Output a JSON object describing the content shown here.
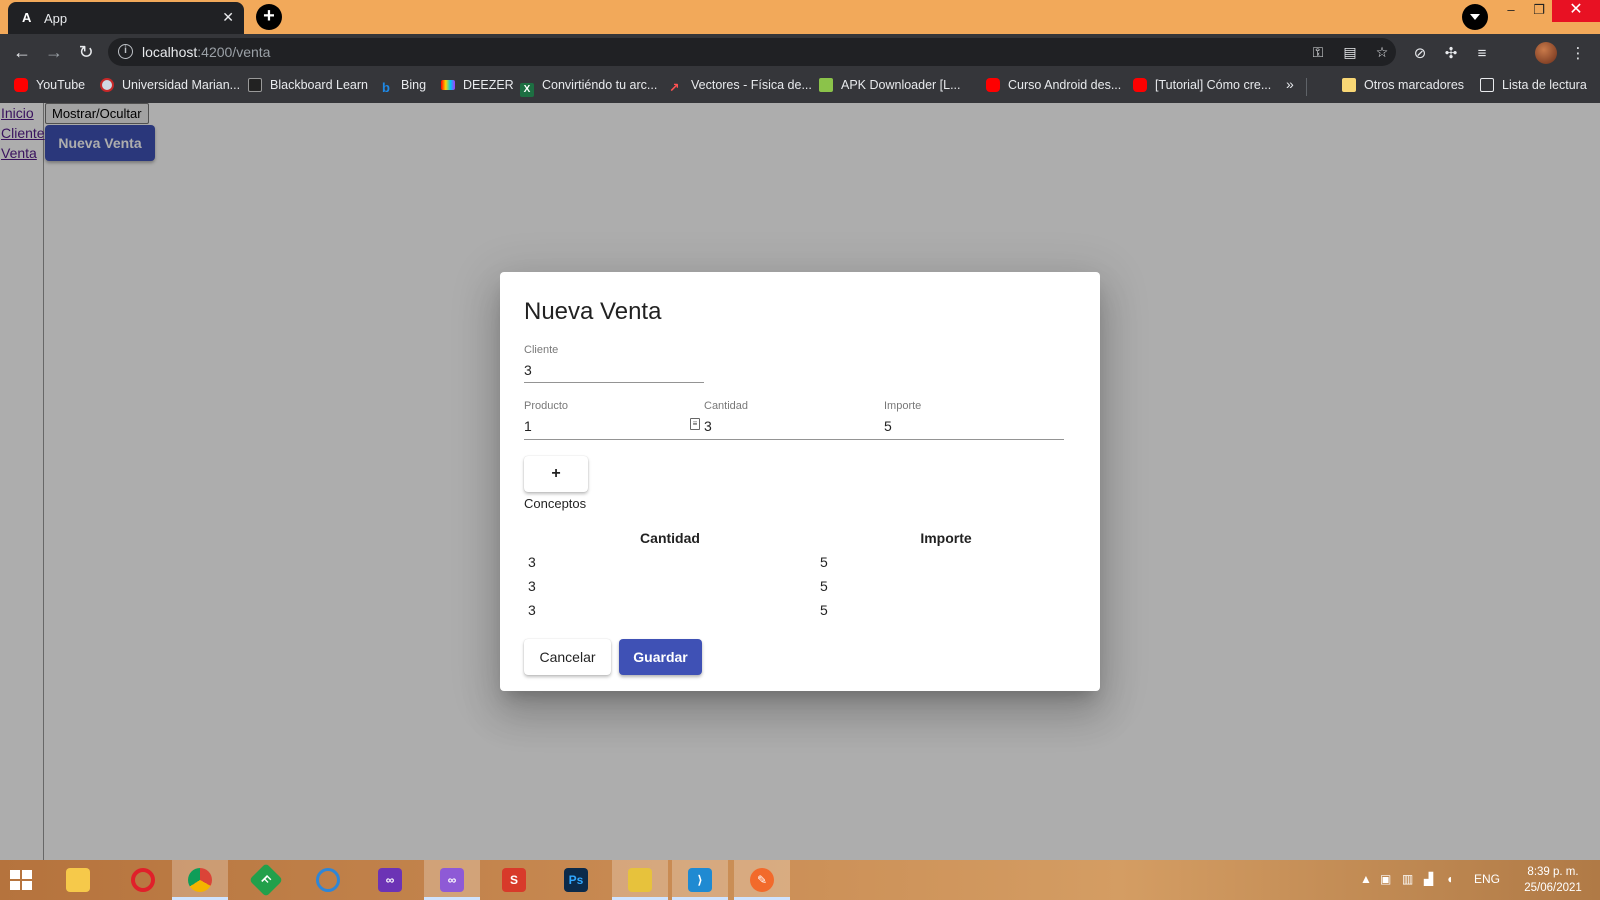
{
  "browser": {
    "tab_title": "App",
    "tab_favicon": "A",
    "url_host": "localhost",
    "url_path": ":4200/venta",
    "new_tab": "+",
    "minimize": "–",
    "maximize": "❐",
    "close": "✕"
  },
  "bookmarks": [
    {
      "label": "YouTube",
      "icon": "youtube-icon"
    },
    {
      "label": "Universidad Marian...",
      "icon": "university-icon"
    },
    {
      "label": "Blackboard Learn",
      "icon": "blackboard-icon"
    },
    {
      "label": "Bing",
      "icon": "bing-icon"
    },
    {
      "label": "DEEZER",
      "icon": "deezer-icon"
    },
    {
      "label": "Convirtiéndo tu arc...",
      "icon": "excel-icon"
    },
    {
      "label": "Vectores - Física de...",
      "icon": "vectores-icon"
    },
    {
      "label": "APK Downloader [L...",
      "icon": "apk-icon"
    },
    {
      "label": "Curso Android des...",
      "icon": "youtube-icon"
    },
    {
      "label": "[Tutorial] Cómo cre...",
      "icon": "youtube-icon"
    }
  ],
  "bookmarks_more": "»",
  "other_bookmarks": "Otros marcadores",
  "reading_list": "Lista de lectura",
  "sidenav": {
    "items": [
      "Inicio",
      "Cliente",
      "Venta"
    ]
  },
  "page": {
    "toggle_label": "Mostrar/Ocultar",
    "new_sale_label": "Nueva Venta"
  },
  "dialog": {
    "title": "Nueva Venta",
    "cliente": {
      "label": "Cliente",
      "value": "3"
    },
    "producto": {
      "label": "Producto",
      "value": "1"
    },
    "cantidad": {
      "label": "Cantidad",
      "value": "3"
    },
    "importe": {
      "label": "Importe",
      "value": "5"
    },
    "add_label": "+",
    "conceptos_label": "Conceptos",
    "table": {
      "headers": [
        "Cantidad",
        "Importe"
      ],
      "rows": [
        [
          "3",
          "5"
        ],
        [
          "3",
          "5"
        ],
        [
          "3",
          "5"
        ]
      ]
    },
    "cancel_label": "Cancelar",
    "save_label": "Guardar"
  },
  "taskbar": {
    "apps": [
      "file-explorer",
      "opera",
      "chrome",
      "app-f",
      "eclipse",
      "visual-studio",
      "visual-studio-preview",
      "sketchup",
      "photoshop",
      "app-xampp",
      "vscode",
      "app-pen"
    ],
    "language": "ENG",
    "time": "8:39 p. m.",
    "date": "25/06/2021"
  },
  "colors": {
    "accent": "#3f51b5",
    "tabstrip": "#f2a95a",
    "chrome_dark": "#35363a"
  }
}
